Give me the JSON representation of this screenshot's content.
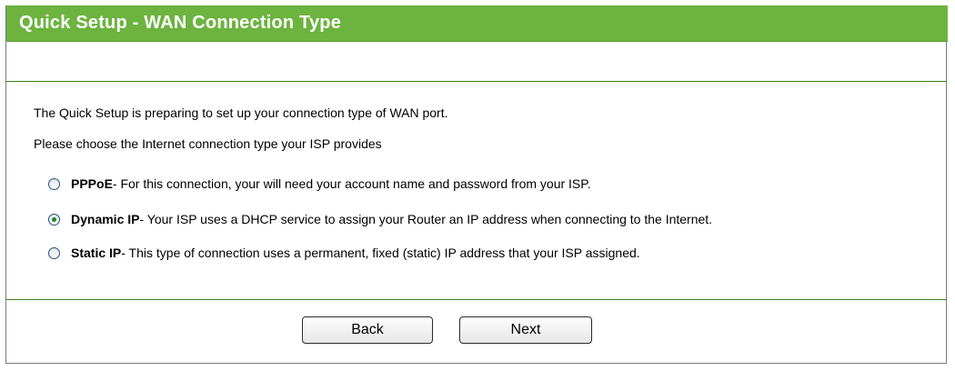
{
  "header": {
    "title": "Quick Setup - WAN Connection Type"
  },
  "intro": {
    "line1": "The Quick Setup is preparing to set up your connection type of WAN port.",
    "line2": "Please choose the Internet connection type your ISP provides"
  },
  "options": [
    {
      "name": "PPPoE",
      "description": " - For this connection, your will need your account name and password from your ISP.",
      "selected": false
    },
    {
      "name": "Dynamic IP",
      "description": " - Your ISP uses a DHCP service to assign your Router an IP address when connecting to the Internet.",
      "selected": true
    },
    {
      "name": "Static IP",
      "description": " - This type of connection uses a permanent, fixed (static) IP address that your ISP assigned.",
      "selected": false
    }
  ],
  "buttons": {
    "back_label": "Back",
    "next_label": "Next"
  },
  "colors": {
    "title_bar": "#6db33f",
    "divider": "#3f7f1f"
  }
}
